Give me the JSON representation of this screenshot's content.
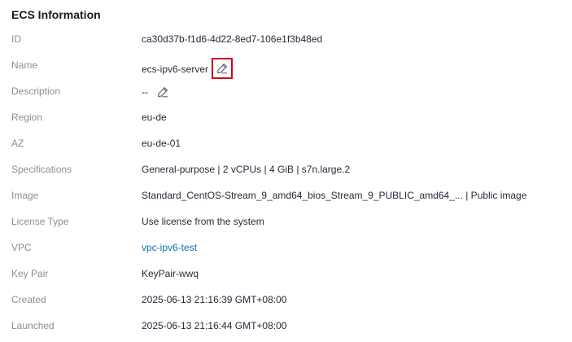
{
  "section": {
    "title": "ECS Information"
  },
  "fields": {
    "id": {
      "label": "ID",
      "value": "ca30d37b-f1d6-4d22-8ed7-106e1f3b48ed"
    },
    "name": {
      "label": "Name",
      "value": "ecs-ipv6-server",
      "edit_icon": "pencil-icon"
    },
    "description": {
      "label": "Description",
      "value": "--",
      "edit_icon": "pencil-icon"
    },
    "region": {
      "label": "Region",
      "value": "eu-de"
    },
    "az": {
      "label": "AZ",
      "value": "eu-de-01"
    },
    "specifications": {
      "label": "Specifications",
      "value": "General-purpose | 2 vCPUs | 4 GiB | s7n.large.2"
    },
    "image": {
      "label": "Image",
      "value": "Standard_CentOS-Stream_9_amd64_bios_Stream_9_PUBLIC_amd64_...  | Public image"
    },
    "license_type": {
      "label": "License Type",
      "value": "Use license from the system"
    },
    "vpc": {
      "label": "VPC",
      "value": "vpc-ipv6-test"
    },
    "key_pair": {
      "label": "Key Pair",
      "value": "KeyPair-wwq"
    },
    "created": {
      "label": "Created",
      "value": "2025-06-13 21:16:39 GMT+08:00"
    },
    "launched": {
      "label": "Launched",
      "value": "2025-06-13 21:16:44 GMT+08:00"
    }
  },
  "colors": {
    "label": "#8a8e99",
    "value": "#252b3a",
    "link": "#0f6fb3",
    "highlight_border": "#d0021b"
  }
}
